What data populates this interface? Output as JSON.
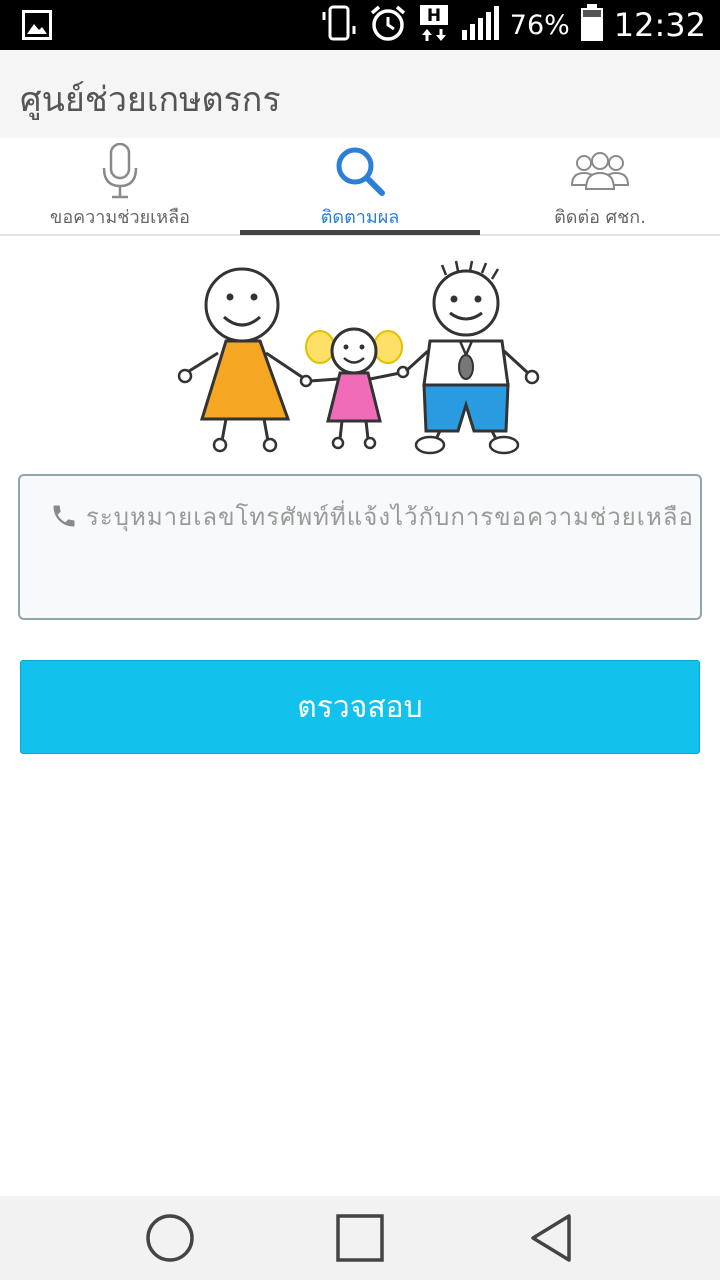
{
  "status_bar": {
    "network_type": "H",
    "battery_percent": "76%",
    "time": "12:32",
    "icons": [
      "gallery-icon",
      "vibrate-icon",
      "alarm-icon",
      "network-h-icon",
      "signal-icon",
      "battery-icon"
    ]
  },
  "app_bar": {
    "title": "ศูนย์ช่วยเกษตรกร"
  },
  "tabs": [
    {
      "label": "ขอความช่วยเหลือ",
      "icon": "microphone-icon",
      "active": false
    },
    {
      "label": "ติดตามผล",
      "icon": "search-icon",
      "active": true
    },
    {
      "label": "ติดต่อ ศชก.",
      "icon": "people-icon",
      "active": false
    }
  ],
  "illustration": {
    "icon": "family-drawing-icon"
  },
  "phone_field": {
    "icon": "phone-icon",
    "placeholder": "ระบุหมายเลขโทรศัพท์ที่แจ้งไว้กับการขอความช่วยเหลือ",
    "value": ""
  },
  "check_button": {
    "label": "ตรวจสอบ"
  },
  "nav_bar": {
    "icons": [
      "home-circle-icon",
      "recents-square-icon",
      "back-triangle-icon"
    ]
  },
  "colors": {
    "accent": "#13c1ed",
    "active_tab": "#2b7fd6",
    "status_bar": "#000000",
    "app_bar": "#f5f5f5"
  }
}
